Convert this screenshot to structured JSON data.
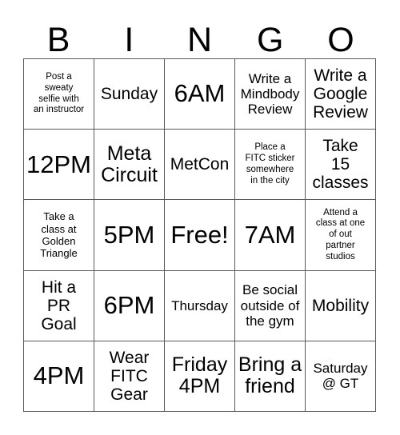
{
  "header": {
    "letters": [
      "B",
      "I",
      "N",
      "G",
      "O"
    ]
  },
  "grid": {
    "rows": 5,
    "columns": 5,
    "border_color": "#5a5a5a",
    "background_color": "#ffffff",
    "text_color": "#000000",
    "cells": [
      {
        "text": "Post a\nsweaty\nselfie with\nan instructor",
        "size": "fs-xs"
      },
      {
        "text": "Sunday",
        "size": "fs-l"
      },
      {
        "text": "6AM",
        "size": "fs-xxl"
      },
      {
        "text": "Write a\nMindbody\nReview",
        "size": "fs-m"
      },
      {
        "text": "Write a\nGoogle\nReview",
        "size": "fs-l"
      },
      {
        "text": "12PM",
        "size": "fs-xxl"
      },
      {
        "text": "Meta\nCircuit",
        "size": "fs-xl"
      },
      {
        "text": "MetCon",
        "size": "fs-l"
      },
      {
        "text": "Place a\nFITC sticker\nsomewhere\nin the city",
        "size": "fs-xs"
      },
      {
        "text": "Take\n15\nclasses",
        "size": "fs-l"
      },
      {
        "text": "Take a\nclass at\nGolden\nTriangle",
        "size": "fs-s"
      },
      {
        "text": "5PM",
        "size": "fs-xxl"
      },
      {
        "text": "Free!",
        "size": "fs-xxl"
      },
      {
        "text": "7AM",
        "size": "fs-xxl"
      },
      {
        "text": "Attend a\nclass at one\nof out\npartner\nstudios",
        "size": "fs-xs"
      },
      {
        "text": "Hit a\nPR\nGoal",
        "size": "fs-l"
      },
      {
        "text": "6PM",
        "size": "fs-xxl"
      },
      {
        "text": "Thursday",
        "size": "fs-m"
      },
      {
        "text": "Be social\noutside of\nthe gym",
        "size": "fs-m"
      },
      {
        "text": "Mobility",
        "size": "fs-l"
      },
      {
        "text": "4PM",
        "size": "fs-xxl"
      },
      {
        "text": "Wear\nFITC\nGear",
        "size": "fs-l"
      },
      {
        "text": "Friday\n4PM",
        "size": "fs-xl"
      },
      {
        "text": "Bring a\nfriend",
        "size": "fs-xl"
      },
      {
        "text": "Saturday\n@ GT",
        "size": "fs-m"
      }
    ]
  }
}
